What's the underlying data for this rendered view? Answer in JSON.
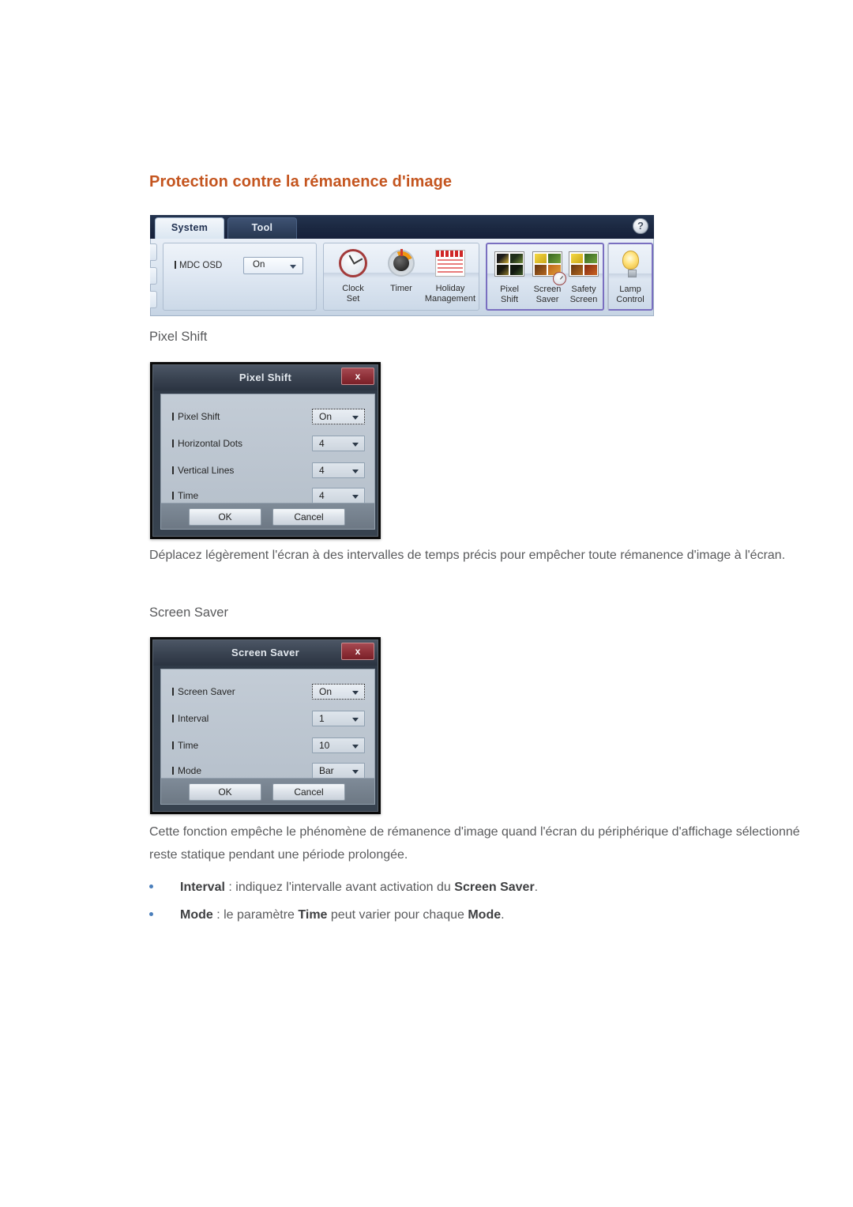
{
  "document": {
    "heading": "Protection contre la rémanence d'image",
    "section_pixel_shift_title": "Pixel Shift",
    "section_screen_saver_title": "Screen Saver",
    "paragraph_pixel_shift": "Déplacez légèrement l'écran à des intervalles de temps précis pour empêcher toute rémanence d'image à l'écran.",
    "paragraph_screen_saver": "Cette fonction empêche le phénomène de rémanence d'image quand l'écran du périphérique d'affichage sélectionné reste statique pendant une période prolongée.",
    "bullets": [
      {
        "lead": "Interval",
        "mid": " : indiquez l'intervalle avant activation du ",
        "strong": "Screen Saver",
        "tail": "."
      },
      {
        "lead": "Mode",
        "mid": " : le paramètre ",
        "strong": "Time",
        "mid2": " peut varier pour chaque ",
        "strong2": "Mode",
        "tail": "."
      }
    ],
    "colors": {
      "heading": "#c4551f",
      "body_text": "#5a5b5d",
      "bullet": "#4a7ebb",
      "highlight_border": "#7a6fc0"
    }
  },
  "mdc_toolbar": {
    "tabs": [
      {
        "label": "System",
        "selected": true
      },
      {
        "label": "Tool",
        "selected": false
      }
    ],
    "help_icon": "?",
    "osd_panel": {
      "label": "MDC OSD",
      "value": "On"
    },
    "time_group": [
      {
        "icon": "clock-icon",
        "caption": "Clock\nSet"
      },
      {
        "icon": "timer-icon",
        "caption": "Timer"
      },
      {
        "icon": "calendar-icon",
        "caption": "Holiday\nManagement"
      }
    ],
    "protection_group": [
      {
        "icon": "pixel-shift-icon",
        "caption": "Pixel\nShift"
      },
      {
        "icon": "screen-saver-icon",
        "caption": "Screen\nSaver"
      },
      {
        "icon": "safety-screen-icon",
        "caption": "Safety\nScreen"
      }
    ],
    "lamp_group": [
      {
        "icon": "lamp-icon",
        "caption": "Lamp\nControl"
      }
    ]
  },
  "pixel_shift_dialog": {
    "title": "Pixel Shift",
    "close_label": "x",
    "rows": [
      {
        "label": "Pixel Shift",
        "value": "On",
        "focused": true
      },
      {
        "label": "Horizontal Dots",
        "value": "4",
        "focused": false
      },
      {
        "label": "Vertical Lines",
        "value": "4",
        "focused": false
      },
      {
        "label": "Time",
        "value": "4",
        "focused": false
      }
    ],
    "ok_label": "OK",
    "cancel_label": "Cancel"
  },
  "screen_saver_dialog": {
    "title": "Screen Saver",
    "close_label": "x",
    "rows": [
      {
        "label": "Screen Saver",
        "value": "On",
        "focused": true
      },
      {
        "label": "Interval",
        "value": "1",
        "focused": false
      },
      {
        "label": "Time",
        "value": "10",
        "focused": false
      },
      {
        "label": "Mode",
        "value": "Bar",
        "focused": false
      }
    ],
    "ok_label": "OK",
    "cancel_label": "Cancel"
  }
}
